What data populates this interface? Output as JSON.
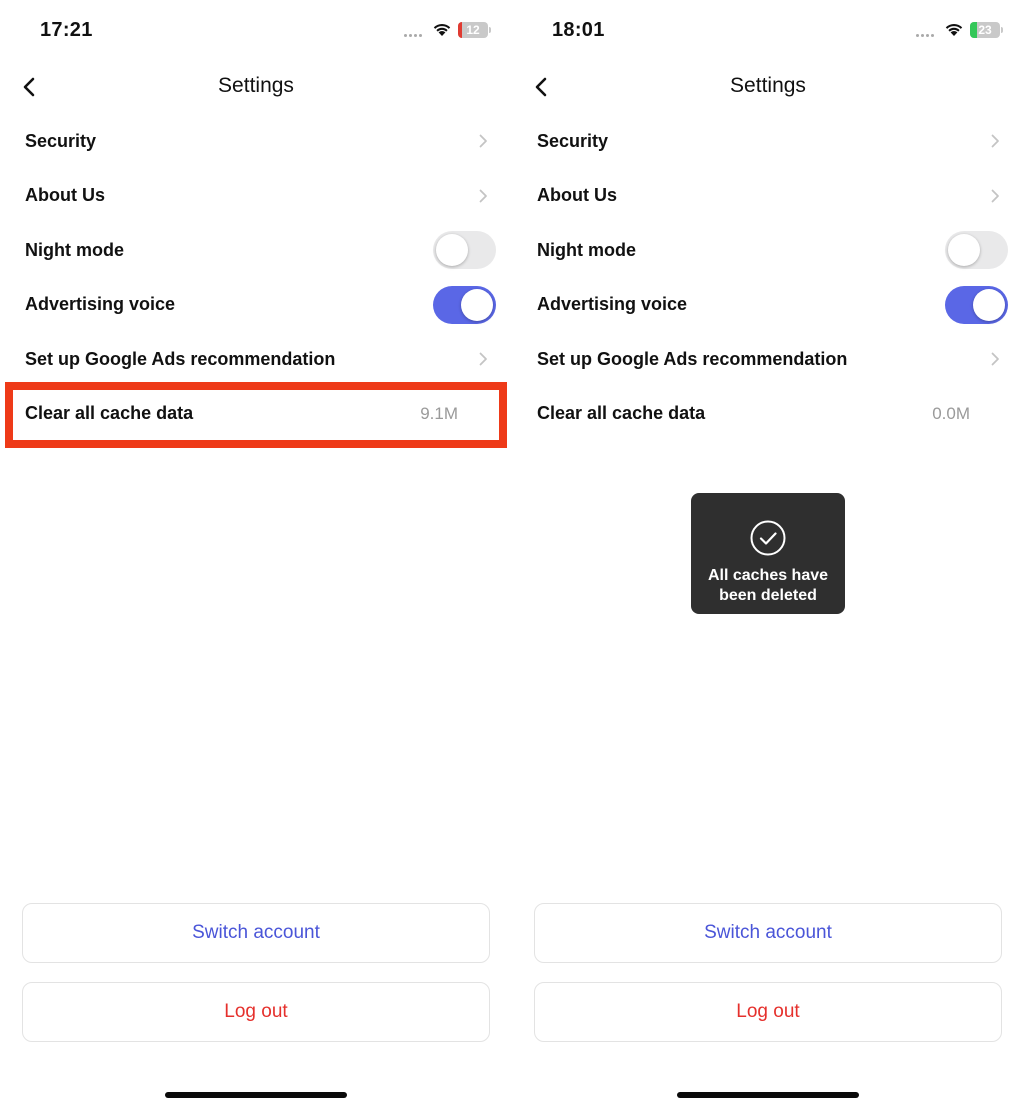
{
  "colors": {
    "accent": "#5a67e6",
    "switch_account_text": "#4a55d8",
    "logout_text": "#e5302c",
    "highlight_border": "#ee3a18",
    "toast_bg": "#2f2f2f",
    "battery_low": "#e03b32",
    "battery_charging": "#34c759"
  },
  "screens": [
    {
      "status": {
        "time": "17:21",
        "battery_text": "12",
        "battery_level": 0.12,
        "battery_state": "low",
        "wifi_icon": "wifi-icon"
      },
      "nav": {
        "title": "Settings",
        "back_icon": "chevron-left-icon"
      },
      "rows": [
        {
          "label": "Security",
          "control": "chevron"
        },
        {
          "label": "About Us",
          "control": "chevron"
        },
        {
          "label": "Night mode",
          "control": "toggle",
          "on": false
        },
        {
          "label": "Advertising voice",
          "control": "toggle",
          "on": true
        },
        {
          "label": "Set up Google Ads recommendation",
          "control": "chevron"
        },
        {
          "label": "Clear all cache data",
          "control": "value",
          "value": "9.1M",
          "highlighted": true
        }
      ],
      "buttons": {
        "switch_account": "Switch account",
        "log_out": "Log out"
      }
    },
    {
      "status": {
        "time": "18:01",
        "battery_text": "23",
        "battery_level": 0.23,
        "battery_state": "charging",
        "wifi_icon": "wifi-icon"
      },
      "nav": {
        "title": "Settings",
        "back_icon": "chevron-left-icon"
      },
      "rows": [
        {
          "label": "Security",
          "control": "chevron"
        },
        {
          "label": "About Us",
          "control": "chevron"
        },
        {
          "label": "Night mode",
          "control": "toggle",
          "on": false
        },
        {
          "label": "Advertising voice",
          "control": "toggle",
          "on": true
        },
        {
          "label": "Set up Google Ads recommendation",
          "control": "chevron"
        },
        {
          "label": "Clear all cache data",
          "control": "value",
          "value": "0.0M",
          "highlighted": false
        }
      ],
      "toast": {
        "icon": "checkmark-circle-icon",
        "text": "All caches have been deleted"
      },
      "buttons": {
        "switch_account": "Switch account",
        "log_out": "Log out"
      }
    }
  ]
}
